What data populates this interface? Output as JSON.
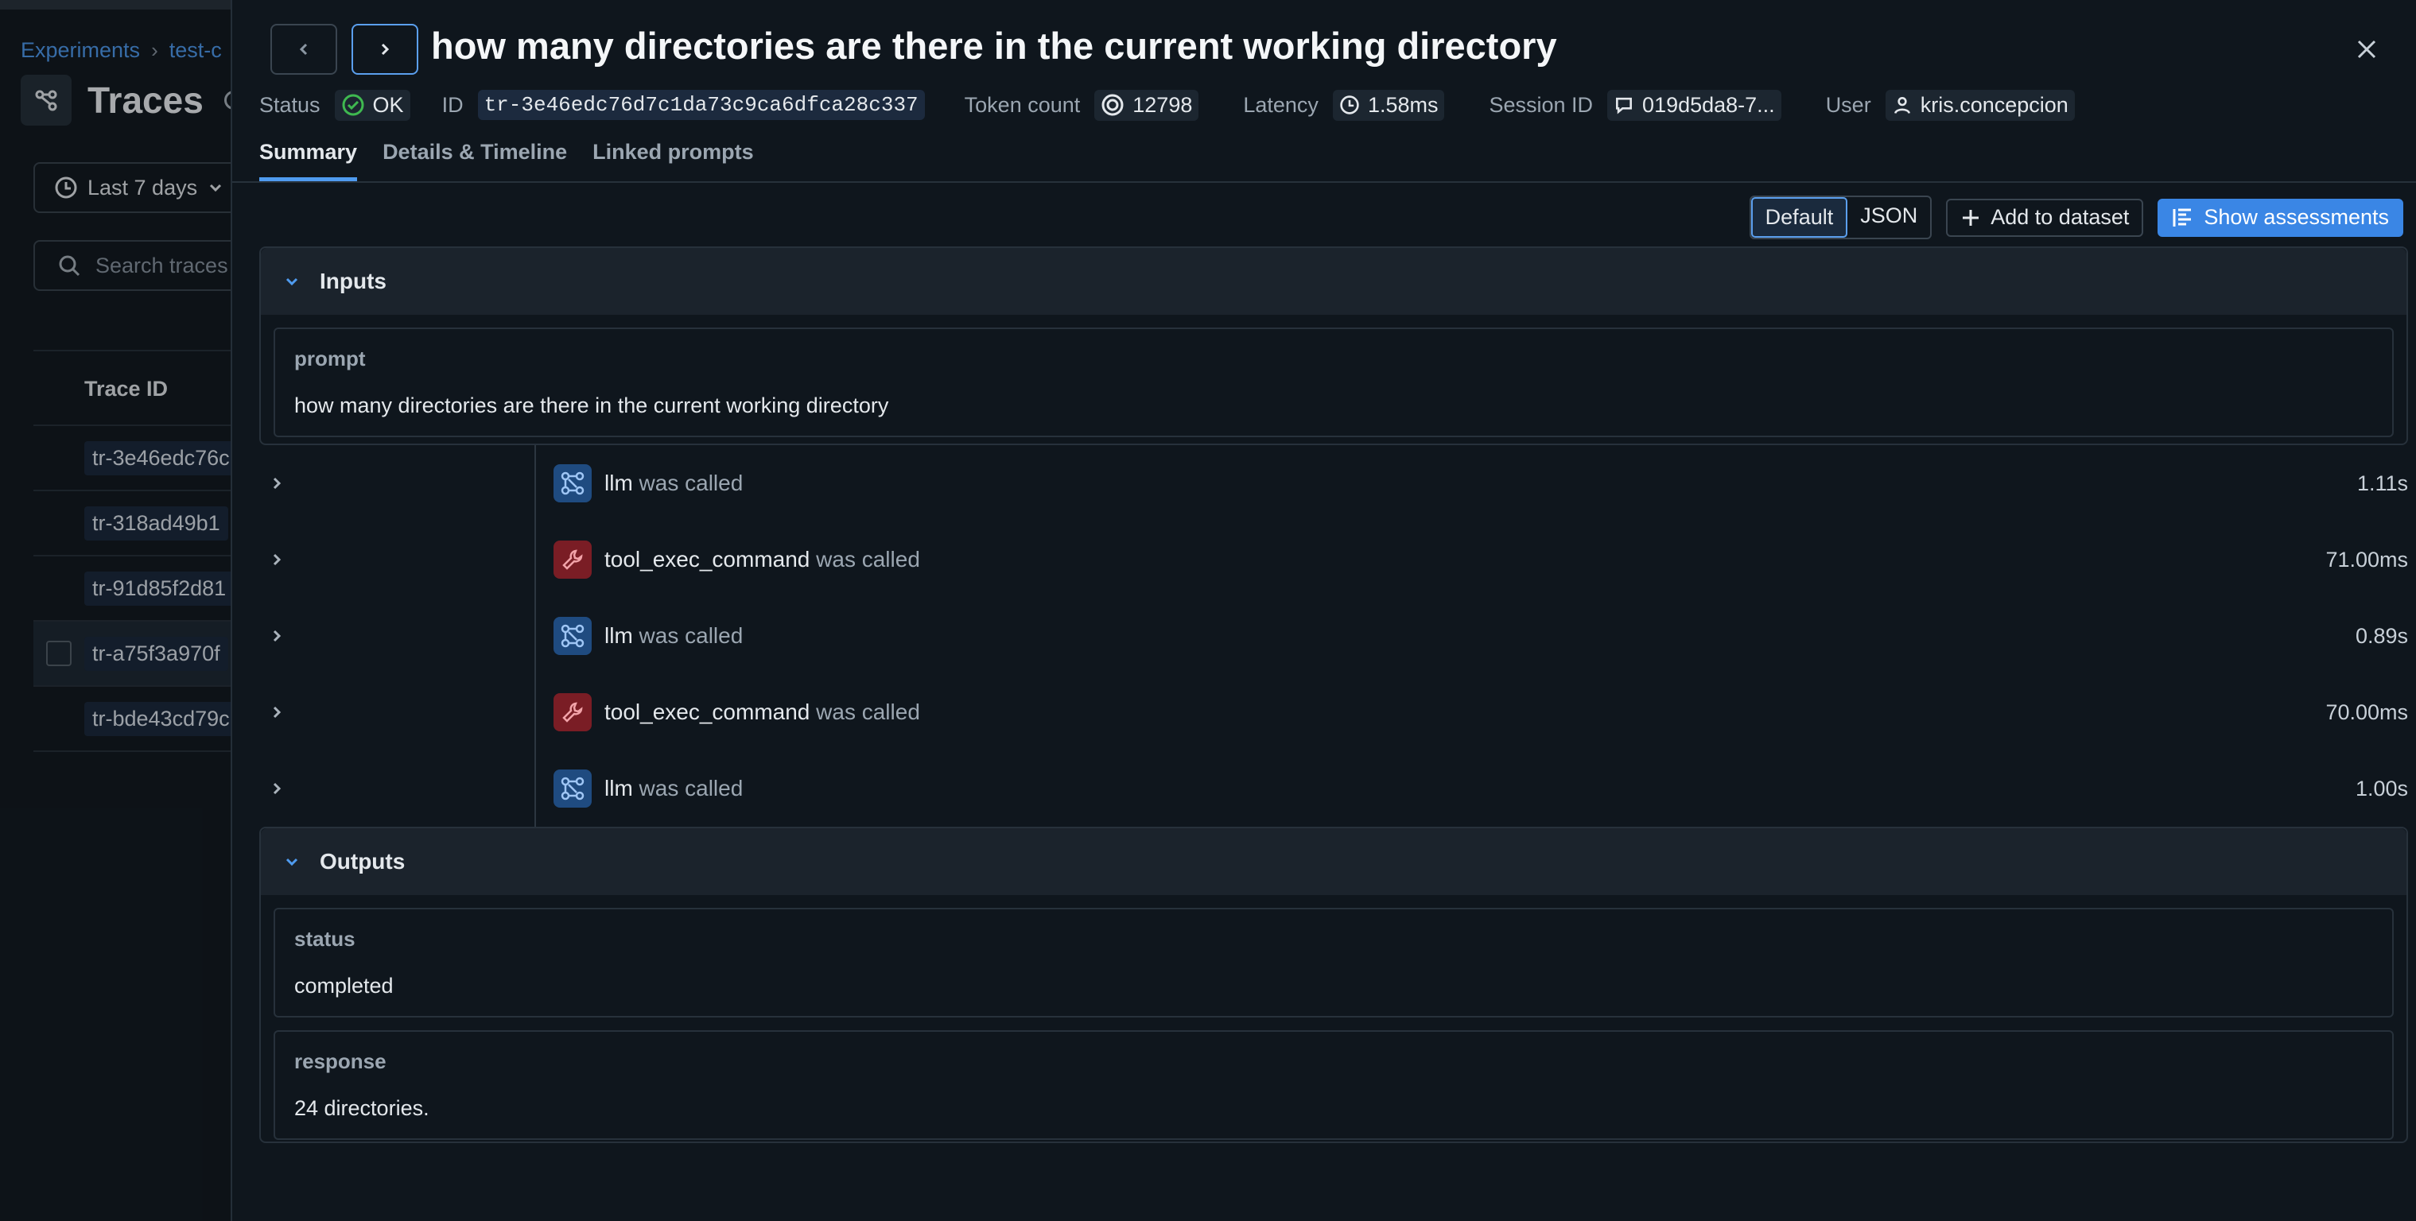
{
  "background": {
    "breadcrumb": {
      "root": "Experiments",
      "current": "test-c"
    },
    "page_title": "Traces",
    "time_range": "Last 7 days",
    "search_placeholder": "Search traces",
    "column_trace_id": "Trace ID",
    "rows": [
      {
        "id": "tr-3e46edc76c"
      },
      {
        "id": "tr-318ad49b1"
      },
      {
        "id": "tr-91d85f2d81"
      },
      {
        "id": "tr-a75f3a970f"
      },
      {
        "id": "tr-bde43cd79c"
      }
    ]
  },
  "drawer": {
    "title": "how many directories are there in the current working directory",
    "meta": {
      "status_label": "Status",
      "status_value": "OK",
      "id_label": "ID",
      "id_value": "tr-3e46edc76d7c1da73c9ca6dfca28c337",
      "token_label": "Token count",
      "token_value": "12798",
      "latency_label": "Latency",
      "latency_value": "1.58ms",
      "session_label": "Session ID",
      "session_value": "019d5da8-7...",
      "user_label": "User",
      "user_value": "kris.concepcion"
    },
    "tabs": [
      "Summary",
      "Details & Timeline",
      "Linked prompts"
    ],
    "toolbar": {
      "view_default": "Default",
      "view_json": "JSON",
      "add_to_dataset": "Add to dataset",
      "show_assessments": "Show assessments"
    },
    "inputs": {
      "title": "Inputs",
      "key": "prompt",
      "value": "how many directories are there in the current working directory"
    },
    "spans": [
      {
        "name": "llm",
        "suffix": "was called",
        "duration": "1.11s",
        "kind": "llm"
      },
      {
        "name": "tool_exec_command",
        "suffix": "was called",
        "duration": "71.00ms",
        "kind": "tool"
      },
      {
        "name": "llm",
        "suffix": "was called",
        "duration": "0.89s",
        "kind": "llm"
      },
      {
        "name": "tool_exec_command",
        "suffix": "was called",
        "duration": "70.00ms",
        "kind": "tool"
      },
      {
        "name": "llm",
        "suffix": "was called",
        "duration": "1.00s",
        "kind": "llm"
      }
    ],
    "outputs": {
      "title": "Outputs",
      "fields": [
        {
          "key": "status",
          "value": "completed"
        },
        {
          "key": "response",
          "value": "24 directories."
        }
      ]
    }
  },
  "colors": {
    "accent": "#4f9bef",
    "ok": "#3fb950",
    "llm_icon_bg": "#1f4b80",
    "tool_icon_bg": "#7a1d25"
  },
  "icons": [
    "traces-icon",
    "info-icon",
    "clock-icon",
    "chevron-down-icon",
    "search-icon",
    "chevron-left-icon",
    "chevron-right-icon",
    "close-icon",
    "check-circle-icon",
    "token-icon",
    "message-icon",
    "user-icon",
    "plus-icon",
    "assessments-icon",
    "llm-icon",
    "wrench-icon"
  ]
}
